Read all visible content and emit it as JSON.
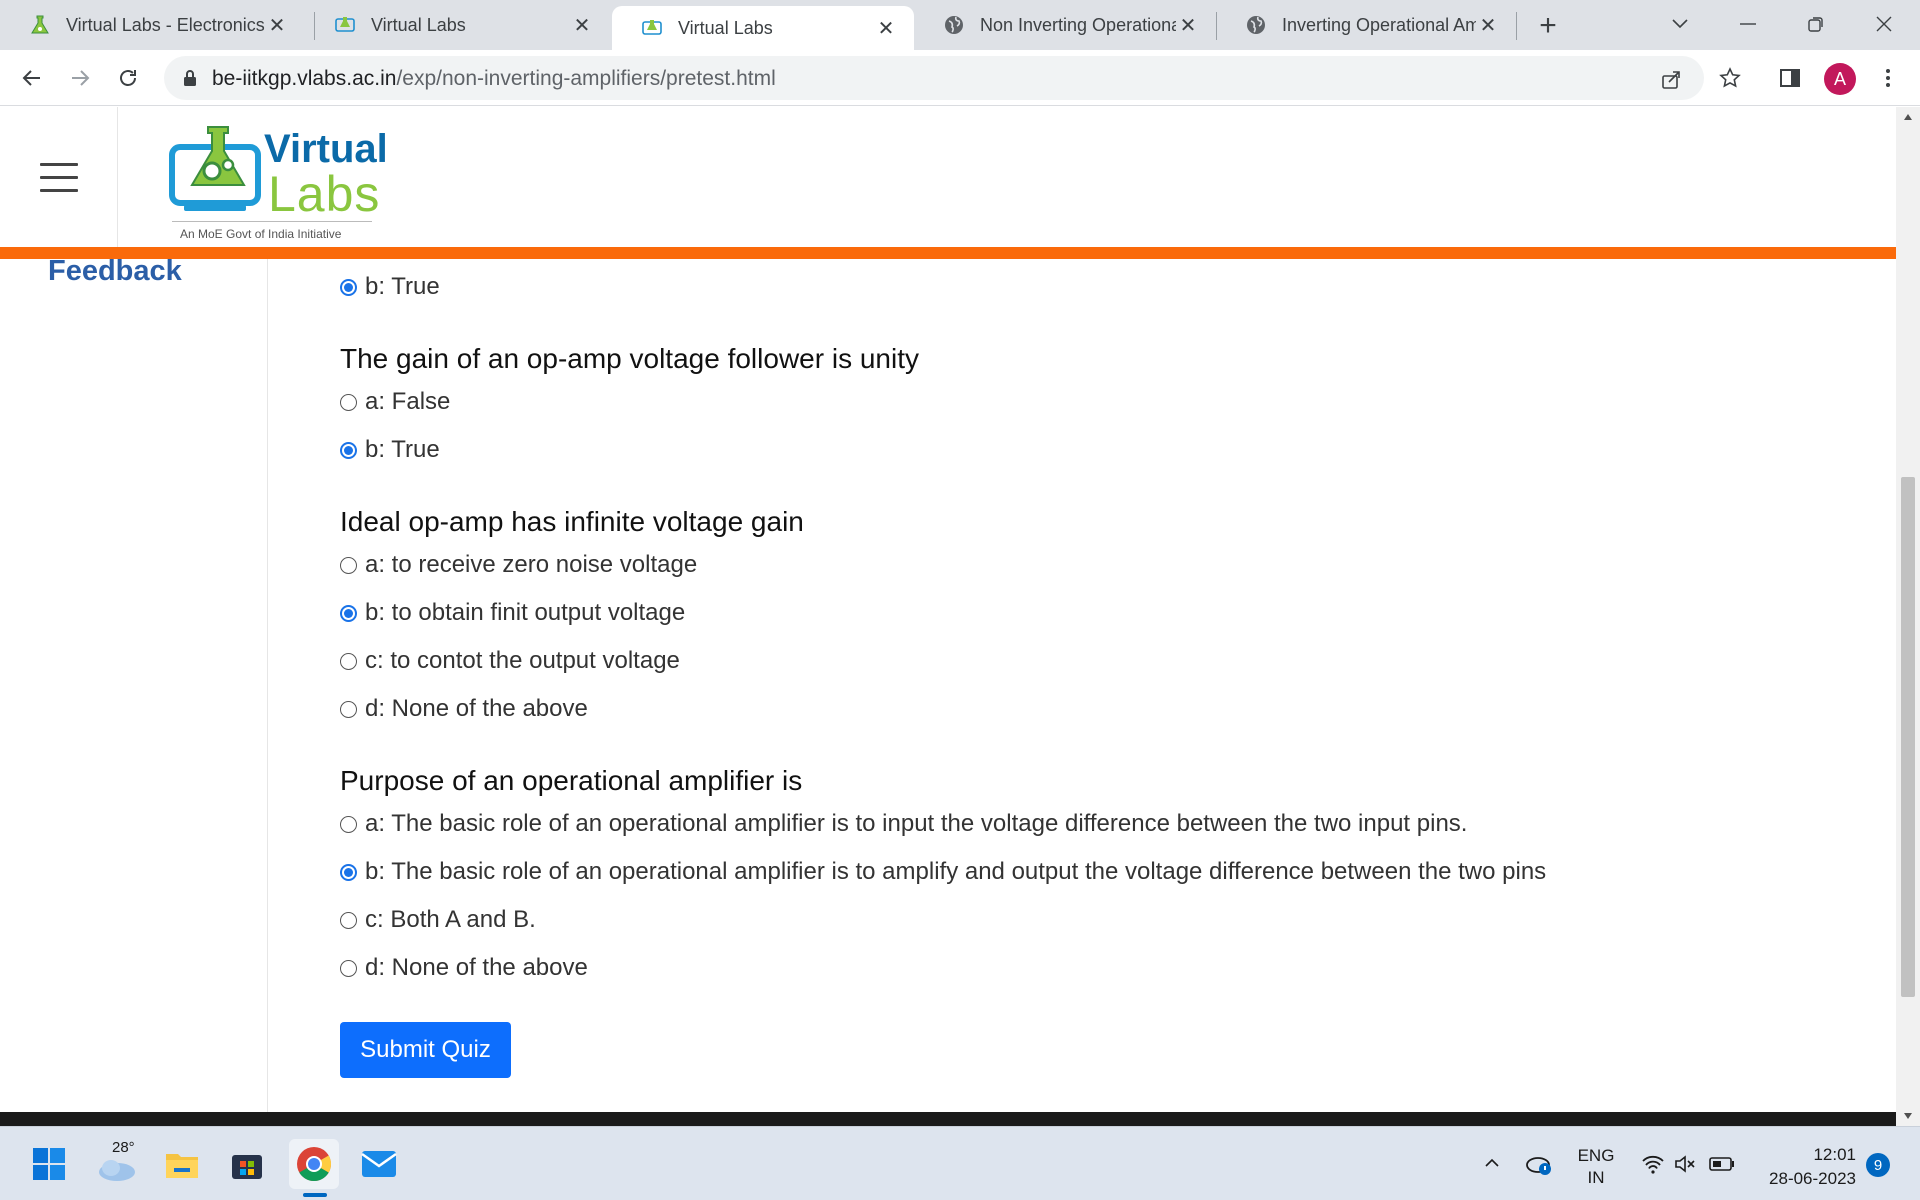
{
  "browser": {
    "tabs": [
      {
        "title": "Virtual Labs - Electronics &",
        "active": false
      },
      {
        "title": "Virtual Labs",
        "active": false
      },
      {
        "title": "Virtual Labs",
        "active": true
      },
      {
        "title": "Non Inverting Operationa",
        "active": false
      },
      {
        "title": "Inverting Operational Am",
        "active": false
      }
    ],
    "close_glyph": "✕",
    "new_tab_glyph": "+",
    "url_host": "be-iitkgp.vlabs.ac.in",
    "url_path": "/exp/non-inverting-amplifiers/pretest.html",
    "profile_initial": "A",
    "icons": [
      "back-arrow-icon",
      "forward-arrow-icon",
      "reload-icon",
      "lock-icon",
      "share-icon",
      "star-icon",
      "side-panel-icon",
      "menu-dots-icon"
    ]
  },
  "site": {
    "logo_word1": "Virtual",
    "logo_word2": "Labs",
    "logo_tagline": "An MoE Govt of India Initiative",
    "feedback_label": "Feedback",
    "accent_orange": "#fa6a0a",
    "link_blue": "#2b5ea7"
  },
  "quiz": {
    "top_option": {
      "label": "b: True",
      "checked": true
    },
    "questions": [
      {
        "text": "The gain of an op-amp voltage follower is unity",
        "options": [
          {
            "label": "a: False",
            "checked": false
          },
          {
            "label": "b: True",
            "checked": true
          }
        ]
      },
      {
        "text": "Ideal op-amp has infinite voltage gain",
        "options": [
          {
            "label": "a: to receive zero noise voltage",
            "checked": false
          },
          {
            "label": "b: to obtain finit output voltage",
            "checked": true
          },
          {
            "label": "c: to contot the output voltage",
            "checked": false
          },
          {
            "label": "d: None of the above",
            "checked": false
          }
        ]
      },
      {
        "text": "Purpose of an operational amplifier is",
        "options": [
          {
            "label": "a: The basic role of an operational amplifier is to input the voltage difference between the two input pins.",
            "checked": false
          },
          {
            "label": "b: The basic role of an operational amplifier is to amplify and output the voltage difference between the two pins",
            "checked": true
          },
          {
            "label": "c: Both A and B.",
            "checked": false
          },
          {
            "label": "d: None of the above",
            "checked": false
          }
        ]
      }
    ],
    "submit_label": "Submit Quiz",
    "button_color": "#0d6efd"
  },
  "taskbar": {
    "weather_temp": "28°",
    "lang_line1": "ENG",
    "lang_line2": "IN",
    "time": "12:01",
    "date": "28-06-2023",
    "notification_count": "9",
    "icons": [
      "windows-start-icon",
      "weather-icon",
      "file-explorer-icon",
      "microsoft-store-icon",
      "chrome-icon",
      "mail-icon",
      "chevron-up-icon",
      "onedrive-icon",
      "wifi-icon",
      "volume-muted-icon",
      "battery-icon"
    ]
  }
}
